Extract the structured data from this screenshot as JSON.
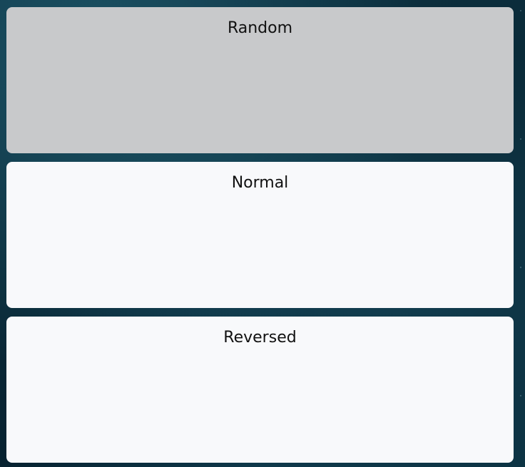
{
  "colors": {
    "panel_background": "#f8f9fb",
    "panel_selected_background": "#c8c9cb",
    "label_text": "#111111"
  },
  "options": [
    {
      "label": "Random",
      "selected": true
    },
    {
      "label": "Normal",
      "selected": false
    },
    {
      "label": "Reversed",
      "selected": false
    }
  ]
}
